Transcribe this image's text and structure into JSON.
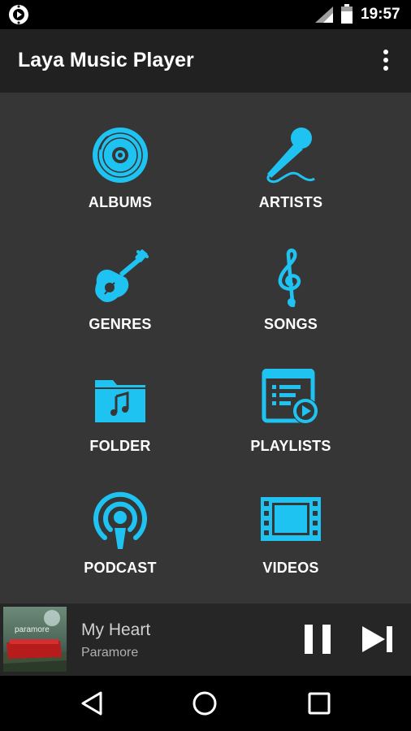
{
  "status_bar": {
    "time": "19:57",
    "icons": [
      "laya-app-icon",
      "signal-icon",
      "battery-icon"
    ]
  },
  "app_bar": {
    "title": "Laya Music Player",
    "menu_icon": "more-vert-icon"
  },
  "accent_color": "#1fc3f2",
  "categories": [
    {
      "label": "ALBUMS",
      "icon": "album-disc-icon"
    },
    {
      "label": "ARTISTS",
      "icon": "microphone-icon"
    },
    {
      "label": "GENRES",
      "icon": "guitar-icon"
    },
    {
      "label": "SONGS",
      "icon": "treble-clef-icon"
    },
    {
      "label": "FOLDER",
      "icon": "music-folder-icon"
    },
    {
      "label": "PLAYLISTS",
      "icon": "playlist-icon"
    },
    {
      "label": "PODCAST",
      "icon": "podcast-icon"
    },
    {
      "label": "VIDEOS",
      "icon": "film-icon"
    }
  ],
  "now_playing": {
    "title": "My Heart",
    "artist": "Paramore",
    "album_art_text": "paramore",
    "controls": [
      "pause-icon",
      "skip-next-icon"
    ]
  },
  "nav_bar": {
    "buttons": [
      "back-icon",
      "home-icon",
      "recent-apps-icon"
    ]
  }
}
